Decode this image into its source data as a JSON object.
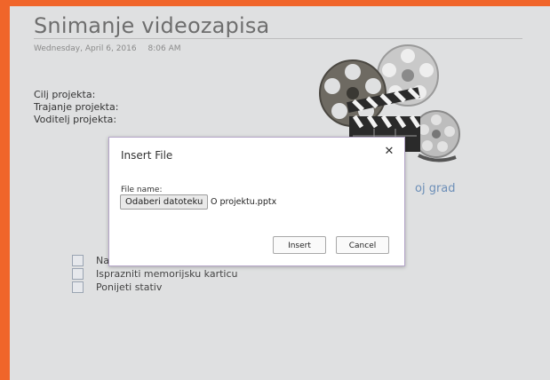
{
  "page": {
    "title": "Snimanje videozapisa",
    "date": "Wednesday, April 6, 2016",
    "time": "8:06 AM",
    "fields": [
      "Cilj projekta:",
      "Trajanje projekta:",
      "Voditelj projekta:"
    ],
    "partial_link": "oj grad",
    "todos": [
      {
        "label": "Na",
        "checked": false
      },
      {
        "label": "Isprazniti memorijsku karticu",
        "checked": false
      },
      {
        "label": "Ponijeti stativ",
        "checked": false
      }
    ],
    "image": "film-reels-and-clapperboard"
  },
  "dialog": {
    "title": "Insert File",
    "close_glyph": "✕",
    "field_label": "File name:",
    "browse_label": "Odaberi datoteku",
    "filename": "O projektu.pptx",
    "insert_label": "Insert",
    "cancel_label": "Cancel"
  },
  "colors": {
    "frame": "#f0652a",
    "page_bg": "#dfe0e1",
    "link": "#6d8fb8",
    "dialog_border": "#b5a6c9"
  }
}
